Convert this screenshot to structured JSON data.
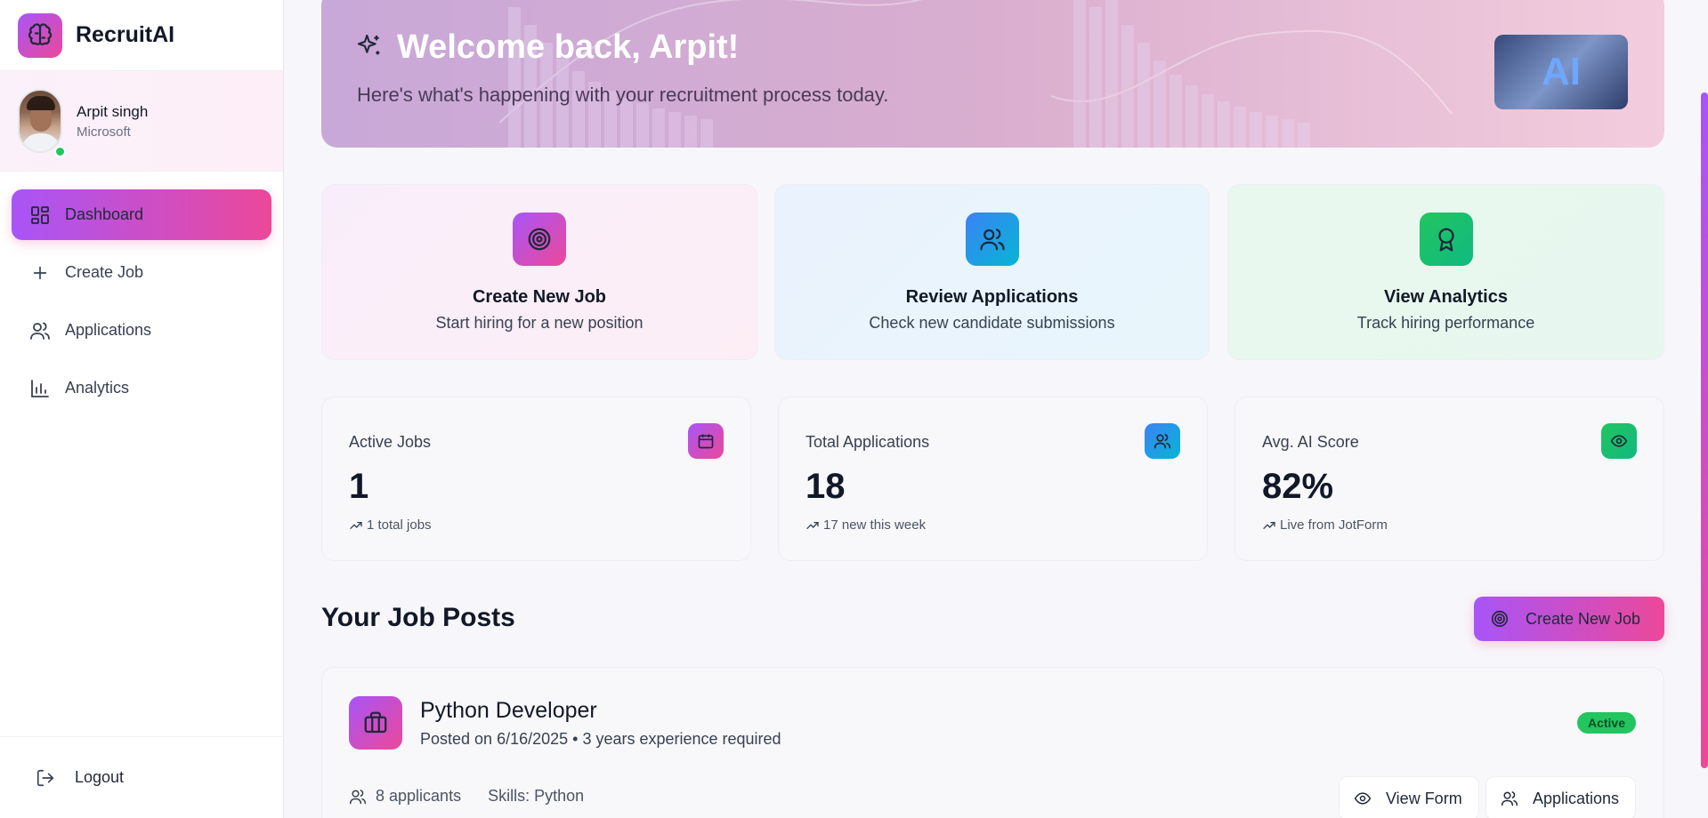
{
  "app": {
    "name": "RecruitAI"
  },
  "user": {
    "name": "Arpit singh",
    "company": "Microsoft"
  },
  "sidebar": {
    "items": [
      {
        "label": "Dashboard",
        "icon": "dashboard-grid-icon",
        "active": true
      },
      {
        "label": "Create Job",
        "icon": "plus-icon"
      },
      {
        "label": "Applications",
        "icon": "users-icon"
      },
      {
        "label": "Analytics",
        "icon": "bar-chart-icon"
      }
    ],
    "logout": "Logout"
  },
  "hero": {
    "title": "Welcome back, Arpit!",
    "subtitle": "Here's what's happening with your recruitment process today.",
    "image_text": "AI"
  },
  "quick_actions": [
    {
      "title": "Create New Job",
      "subtitle": "Start hiring for a new position",
      "icon": "target-icon",
      "color": "#ec4899"
    },
    {
      "title": "Review Applications",
      "subtitle": "Check new candidate submissions",
      "icon": "users-icon",
      "color": "#0ea5e9"
    },
    {
      "title": "View Analytics",
      "subtitle": "Track hiring performance",
      "icon": "award-icon",
      "color": "#22c55e"
    }
  ],
  "stats": [
    {
      "label": "Active Jobs",
      "value": "1",
      "note": "1 total jobs",
      "icon": "calendar-icon"
    },
    {
      "label": "Total Applications",
      "value": "18",
      "note": "17 new this week",
      "icon": "users-icon"
    },
    {
      "label": "Avg. AI Score",
      "value": "82%",
      "note": "Live from JotForm",
      "icon": "eye-icon"
    }
  ],
  "jobs_section": {
    "title": "Your Job Posts",
    "create_button": "Create New Job"
  },
  "jobs": [
    {
      "title": "Python Developer",
      "meta": "Posted on 6/16/2025 • 3 years experience required",
      "status": "Active",
      "applicants": "8 applicants",
      "skills": "Skills: Python",
      "view_form": "View Form",
      "applications": "Applications"
    }
  ],
  "colors": {
    "accent_start": "#a855f7",
    "accent_end": "#ec4899",
    "blue": "#0ea5e9",
    "green": "#22c55e"
  }
}
